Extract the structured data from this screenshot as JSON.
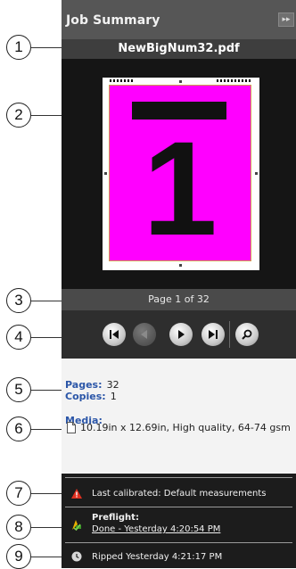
{
  "panel": {
    "title": "Job Summary",
    "collapse_symbol": "▸▸",
    "filename": "NewBigNum32.pdf"
  },
  "preview": {
    "page_number_glyph": "1",
    "page_fill_color": "#ff00ff"
  },
  "page_info": "Page 1 of 32",
  "navigation": {
    "buttons": [
      "first-page",
      "previous-page",
      "next-page",
      "last-page",
      "zoom"
    ]
  },
  "details": {
    "pages_label": "Pages:",
    "pages_value": "32",
    "copies_label": "Copies:",
    "copies_value": "1",
    "media_label": "Media:",
    "media_value": "10.19in x 12.69in, High quality, 64-74 gsm"
  },
  "status": {
    "calibration_text": "Last calibrated: Default measurements",
    "preflight_label": "Preflight:",
    "preflight_link": "Done - Yesterday 4:20:54 PM",
    "ripped_text": "Ripped Yesterday 4:21:17 PM"
  },
  "callouts": [
    "1",
    "2",
    "3",
    "4",
    "5",
    "6",
    "7",
    "8",
    "9"
  ]
}
